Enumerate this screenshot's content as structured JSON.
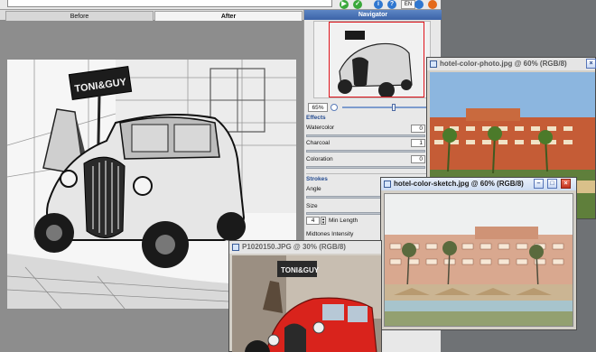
{
  "toolbar": {
    "buttons": [
      {
        "icon": "play-icon",
        "glyph": "▶",
        "color": "#3aa83a"
      },
      {
        "icon": "check-icon",
        "glyph": "✓",
        "color": "#3aa83a"
      },
      {
        "icon": "info-icon",
        "glyph": "i",
        "color": "#2f77d0"
      },
      {
        "icon": "help-icon",
        "glyph": "?",
        "color": "#2f77d0"
      },
      {
        "icon": "globe-icon",
        "glyph": "",
        "color": "#2f77d0"
      },
      {
        "icon": "settings-icon",
        "glyph": "",
        "color": "#e46a1a"
      }
    ],
    "language": "EN"
  },
  "tabs": {
    "before": "Before",
    "after": "After"
  },
  "navigator": {
    "title": "Navigator",
    "zoom_value": "65%",
    "zoom_fraction": 0.55
  },
  "effects": {
    "section_title": "Effects",
    "watercolor_label": "Watercolor",
    "watercolor_value": "0",
    "charcoal_label": "Charcoal",
    "charcoal_value": "1",
    "coloration_label": "Coloration",
    "coloration_value": "0"
  },
  "strokes": {
    "section_title": "Strokes",
    "angle_label": "Angle",
    "size_label": "Size",
    "min_length_value": "4",
    "min_length_label": "Min Length",
    "midtones_label": "Midtones Intensity"
  },
  "windows": {
    "hotel_photo_title": "hotel-color-photo.jpg @ 60% (RGB/8)",
    "hotel_sketch_title": "hotel-color-sketch.jpg @ 60% (RGB/8)",
    "car_photo_title": "P1020150.JPG @ 30% (RGB/8)"
  },
  "sign_text": "TONI&GUY",
  "colors": {
    "accent": "#3b63a8",
    "frame_red": "#e0141b",
    "car_red": "#d9231c",
    "sky_blue": "#7fa9d6",
    "hotel_orange": "#c45a34"
  }
}
